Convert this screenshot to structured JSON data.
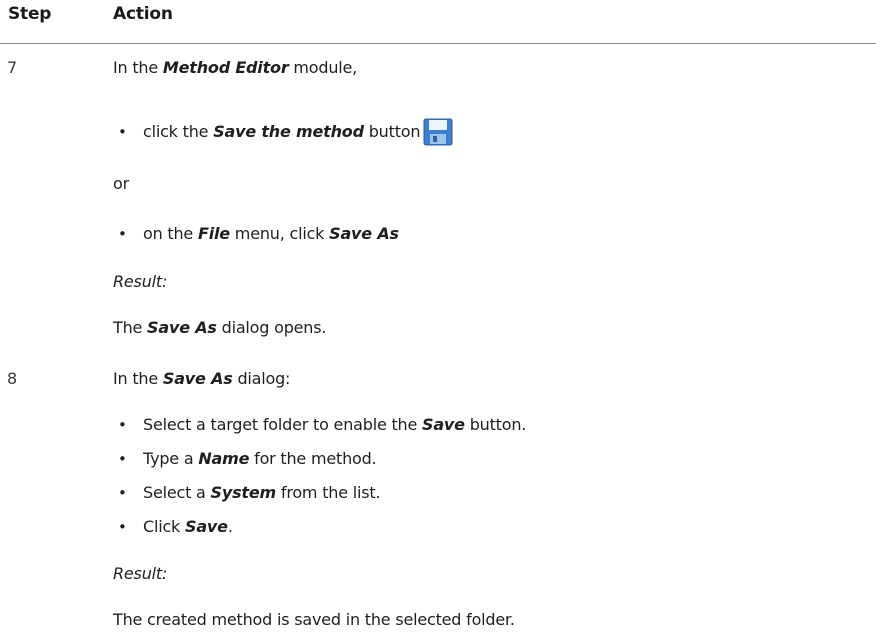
{
  "header": {
    "step": "Step",
    "action": "Action"
  },
  "steps": [
    {
      "number": "7",
      "intro": [
        "In the ",
        "Method Editor",
        " module,"
      ],
      "bullet1": [
        "click the ",
        "Save the method",
        " button"
      ],
      "or": "or",
      "bullet2": [
        "on the ",
        "File",
        " menu, click ",
        "Save As"
      ],
      "result_label": "Result:",
      "result": [
        "The ",
        "Save As",
        " dialog opens."
      ]
    },
    {
      "number": "8",
      "intro": [
        "In the ",
        "Save As",
        " dialog:"
      ],
      "bullets": [
        [
          "Select a target folder to enable the ",
          "Save",
          " button."
        ],
        [
          "Type a ",
          "Name",
          " for the method."
        ],
        [
          "Select a ",
          "System",
          " from the list."
        ],
        [
          "Click ",
          "Save",
          "."
        ]
      ],
      "result_label": "Result:",
      "result": "The created method is saved in the selected folder."
    }
  ],
  "icons": {
    "save": "floppy-disk-icon"
  },
  "colors": {
    "icon_blue": "#3b7fd0",
    "rule": "#8a8a8a"
  }
}
